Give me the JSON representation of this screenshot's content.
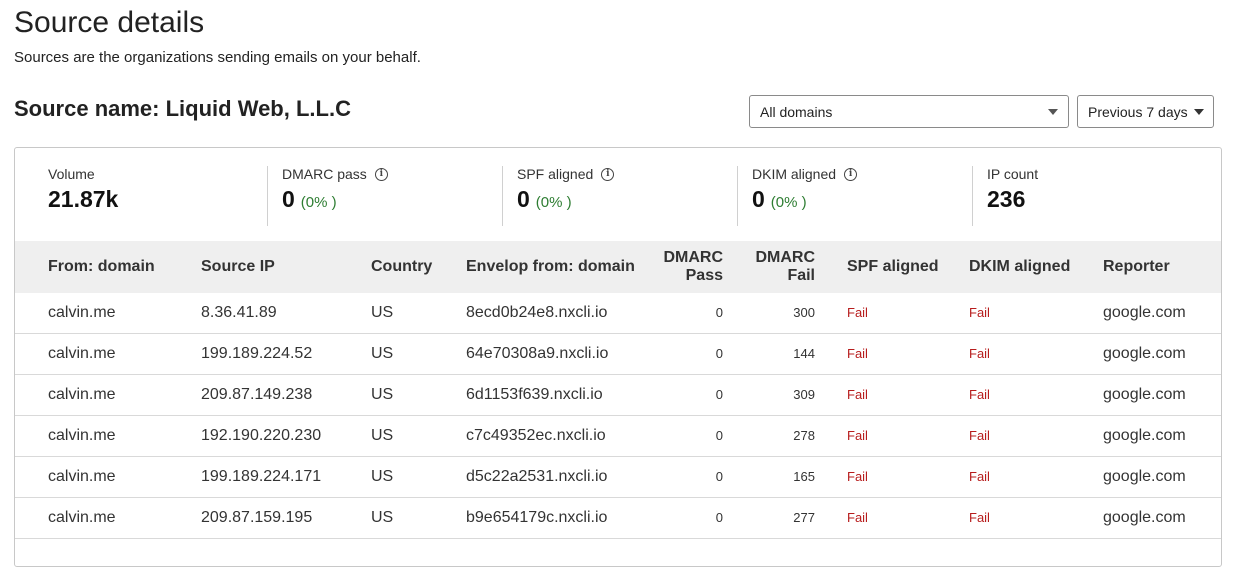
{
  "page": {
    "title": "Source details",
    "subtitle": "Sources are the organizations sending emails on your behalf."
  },
  "source": {
    "label": "Source name: Liquid Web, L.L.C"
  },
  "filters": {
    "domains_value": "All domains",
    "period_value": "Previous 7 days"
  },
  "stats": [
    {
      "label": "Volume",
      "value": "21.87k",
      "pct": ""
    },
    {
      "label": "DMARC pass",
      "value": "0",
      "pct": "(0% )"
    },
    {
      "label": "SPF aligned",
      "value": "0",
      "pct": "(0% )"
    },
    {
      "label": "DKIM aligned",
      "value": "0",
      "pct": "(0% )"
    },
    {
      "label": "IP count",
      "value": "236",
      "pct": ""
    }
  ],
  "table": {
    "columns": {
      "from_domain": "From: domain",
      "source_ip": "Source IP",
      "country": "Country",
      "envelop_from": "Envelop from: domain",
      "dmarc_pass_1": "DMARC",
      "dmarc_pass_2": "Pass",
      "dmarc_fail_1": "DMARC",
      "dmarc_fail_2": "Fail",
      "spf_aligned": "SPF aligned",
      "dkim_aligned": "DKIM aligned",
      "reporter": "Reporter"
    },
    "rows": [
      {
        "from_domain": "calvin.me",
        "source_ip": "8.36.41.89",
        "country": "US",
        "envelop_from": "8ecd0b24e8.nxcli.io",
        "dmarc_pass": "0",
        "dmarc_fail": "300",
        "spf": "Fail",
        "dkim": "Fail",
        "reporter": "google.com"
      },
      {
        "from_domain": "calvin.me",
        "source_ip": "199.189.224.52",
        "country": "US",
        "envelop_from": "64e70308a9.nxcli.io",
        "dmarc_pass": "0",
        "dmarc_fail": "144",
        "spf": "Fail",
        "dkim": "Fail",
        "reporter": "google.com"
      },
      {
        "from_domain": "calvin.me",
        "source_ip": "209.87.149.238",
        "country": "US",
        "envelop_from": "6d1153f639.nxcli.io",
        "dmarc_pass": "0",
        "dmarc_fail": "309",
        "spf": "Fail",
        "dkim": "Fail",
        "reporter": "google.com"
      },
      {
        "from_domain": "calvin.me",
        "source_ip": "192.190.220.230",
        "country": "US",
        "envelop_from": "c7c49352ec.nxcli.io",
        "dmarc_pass": "0",
        "dmarc_fail": "278",
        "spf": "Fail",
        "dkim": "Fail",
        "reporter": "google.com"
      },
      {
        "from_domain": "calvin.me",
        "source_ip": "199.189.224.171",
        "country": "US",
        "envelop_from": "d5c22a2531.nxcli.io",
        "dmarc_pass": "0",
        "dmarc_fail": "165",
        "spf": "Fail",
        "dkim": "Fail",
        "reporter": "google.com"
      },
      {
        "from_domain": "calvin.me",
        "source_ip": "209.87.159.195",
        "country": "US",
        "envelop_from": "b9e654179c.nxcli.io",
        "dmarc_pass": "0",
        "dmarc_fail": "277",
        "spf": "Fail",
        "dkim": "Fail",
        "reporter": "google.com"
      }
    ]
  }
}
